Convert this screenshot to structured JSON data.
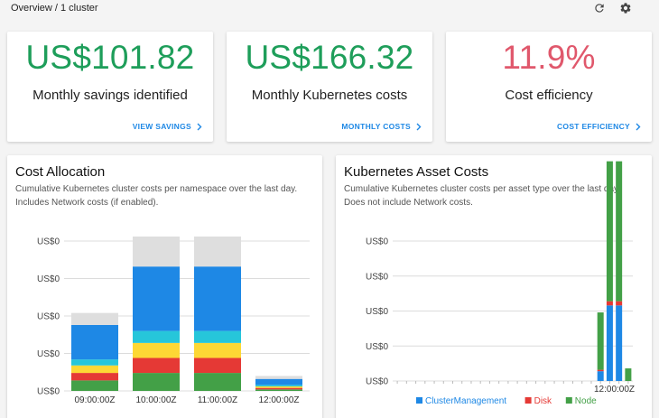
{
  "header": {
    "breadcrumb": "Overview / 1 cluster",
    "refresh_icon": "refresh-icon",
    "settings_icon": "gear-icon"
  },
  "metrics": [
    {
      "value": "US$101.82",
      "label": "Monthly savings identified",
      "link": "VIEW SAVINGS",
      "color": "#1e9e5a"
    },
    {
      "value": "US$166.32",
      "label": "Monthly Kubernetes costs",
      "link": "MONTHLY COSTS",
      "color": "#1e9e5a"
    },
    {
      "value": "11.9%",
      "label": "Cost efficiency",
      "link": "COST EFFICIENCY",
      "color": "#e0586c"
    }
  ],
  "cost_allocation": {
    "title": "Cost Allocation",
    "subtitle": "Cumulative Kubernetes cluster costs per namespace over the last day. Includes Network costs (if enabled)."
  },
  "asset_costs": {
    "title": "Kubernetes Asset Costs",
    "subtitle": "Cumulative Kubernetes cluster costs per asset type over the last day. Does not include Network costs."
  },
  "chart_data": [
    {
      "type": "bar",
      "stacked": true,
      "categories": [
        "09:00:00Z",
        "10:00:00Z",
        "11:00:00Z",
        "12:00:00Z"
      ],
      "ytick_labels": [
        "US$0",
        "US$0",
        "US$0",
        "US$0",
        "US$0"
      ],
      "grid": true,
      "series": [
        {
          "color": "#43a047",
          "values": [
            0.07,
            0.12,
            0.12,
            0.01
          ]
        },
        {
          "color": "#e53935",
          "values": [
            0.05,
            0.1,
            0.1,
            0.01
          ]
        },
        {
          "color": "#fdd835",
          "values": [
            0.05,
            0.1,
            0.1,
            0.01
          ]
        },
        {
          "color": "#26c6da",
          "values": [
            0.04,
            0.08,
            0.08,
            0.01
          ]
        },
        {
          "color": "#1e88e5",
          "values": [
            0.23,
            0.43,
            0.43,
            0.04
          ]
        },
        {
          "color": "#dedede",
          "values": [
            0.08,
            0.2,
            0.2,
            0.02
          ]
        }
      ]
    },
    {
      "type": "bar",
      "stacked": true,
      "x_tick_labels": [
        "12:00:00Z"
      ],
      "ytick_labels": [
        "US$0",
        "US$0",
        "US$0",
        "US$0",
        "US$0"
      ],
      "grid": true,
      "legend": "bottom",
      "bar_count": 26,
      "series": [
        {
          "name": "ClusterManagement",
          "color": "#1e88e5",
          "bars": [
            [
              22,
              0.07
            ],
            [
              23,
              0.54
            ],
            [
              24,
              0.54
            ]
          ]
        },
        {
          "name": "Disk",
          "color": "#e53935",
          "bars": [
            [
              22,
              0.01
            ],
            [
              23,
              0.03
            ],
            [
              24,
              0.03
            ]
          ]
        },
        {
          "name": "Node",
          "color": "#43a047",
          "bars": [
            [
              22,
              0.41
            ],
            [
              23,
              1.0
            ],
            [
              24,
              1.0
            ],
            [
              25,
              0.09
            ]
          ]
        }
      ]
    }
  ]
}
